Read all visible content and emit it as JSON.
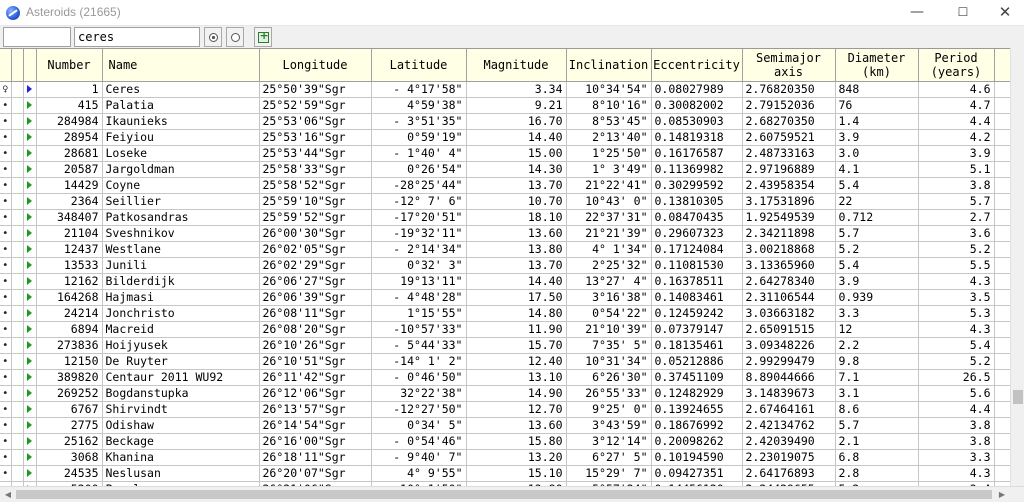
{
  "window": {
    "title": "Asteroids (21665)",
    "minimize_glyph": "—",
    "maximize_glyph": "☐",
    "close_glyph": "✕"
  },
  "toolbar": {
    "field1_value": "",
    "search_value": "ceres"
  },
  "table": {
    "headers": {
      "number": "Number",
      "name": "Name",
      "longitude": "Longitude",
      "latitude": "Latitude",
      "magnitude": "Magnitude",
      "inclination": "Inclination",
      "eccentricity": "Eccentricity",
      "semimajor_line1": "Semimajor",
      "semimajor_line2": "axis",
      "diameter_line1": "Diameter",
      "diameter_line2": "(km)",
      "period_line1": "Period",
      "period_line2": "(years)"
    },
    "rows": [
      {
        "mark": "♀",
        "number": "1",
        "name": "Ceres",
        "longitude": "25°50'39\"Sgr",
        "latitude": "- 4°17'58\"",
        "magnitude": "3.34",
        "inclination": "10°34'54\"",
        "eccentricity": "0.08027989",
        "semimajor": "2.76820350",
        "diameter": "848",
        "period": "4.6"
      },
      {
        "mark": "•",
        "number": "415",
        "name": "Palatia",
        "longitude": "25°52'59\"Sgr",
        "latitude": "4°59'38\"",
        "magnitude": "9.21",
        "inclination": "8°10'16\"",
        "eccentricity": "0.30082002",
        "semimajor": "2.79152036",
        "diameter": "76",
        "period": "4.7"
      },
      {
        "mark": "•",
        "number": "284984",
        "name": "Ikaunieks",
        "longitude": "25°53'06\"Sgr",
        "latitude": "- 3°51'35\"",
        "magnitude": "16.70",
        "inclination": "8°53'45\"",
        "eccentricity": "0.08530903",
        "semimajor": "2.68270350",
        "diameter": "1.4",
        "period": "4.4"
      },
      {
        "mark": "•",
        "number": "28954",
        "name": "Feiyiou",
        "longitude": "25°53'16\"Sgr",
        "latitude": "0°59'19\"",
        "magnitude": "14.40",
        "inclination": "2°13'40\"",
        "eccentricity": "0.14819318",
        "semimajor": "2.60759521",
        "diameter": "3.9",
        "period": "4.2"
      },
      {
        "mark": "•",
        "number": "28681",
        "name": "Loseke",
        "longitude": "25°53'44\"Sgr",
        "latitude": "- 1°40' 4\"",
        "magnitude": "15.00",
        "inclination": "1°25'50\"",
        "eccentricity": "0.16176587",
        "semimajor": "2.48733163",
        "diameter": "3.0",
        "period": "3.9"
      },
      {
        "mark": "•",
        "number": "20587",
        "name": "Jargoldman",
        "longitude": "25°58'33\"Sgr",
        "latitude": "0°26'54\"",
        "magnitude": "14.30",
        "inclination": "1° 3'49\"",
        "eccentricity": "0.11369982",
        "semimajor": "2.97196889",
        "diameter": "4.1",
        "period": "5.1"
      },
      {
        "mark": "•",
        "number": "14429",
        "name": "Coyne",
        "longitude": "25°58'52\"Sgr",
        "latitude": "-28°25'44\"",
        "magnitude": "13.70",
        "inclination": "21°22'41\"",
        "eccentricity": "0.30299592",
        "semimajor": "2.43958354",
        "diameter": "5.4",
        "period": "3.8"
      },
      {
        "mark": "•",
        "number": "2364",
        "name": "Seillier",
        "longitude": "25°59'10\"Sgr",
        "latitude": "-12° 7' 6\"",
        "magnitude": "10.70",
        "inclination": "10°43' 0\"",
        "eccentricity": "0.13810305",
        "semimajor": "3.17531896",
        "diameter": "22",
        "period": "5.7"
      },
      {
        "mark": "•",
        "number": "348407",
        "name": "Patkosandras",
        "longitude": "25°59'52\"Sgr",
        "latitude": "-17°20'51\"",
        "magnitude": "18.10",
        "inclination": "22°37'31\"",
        "eccentricity": "0.08470435",
        "semimajor": "1.92549539",
        "diameter": "0.712",
        "period": "2.7"
      },
      {
        "mark": "•",
        "number": "21104",
        "name": "Sveshnikov",
        "longitude": "26°00'30\"Sgr",
        "latitude": "-19°32'11\"",
        "magnitude": "13.60",
        "inclination": "21°21'39\"",
        "eccentricity": "0.29607323",
        "semimajor": "2.34211898",
        "diameter": "5.7",
        "period": "3.6"
      },
      {
        "mark": "•",
        "number": "12437",
        "name": "Westlane",
        "longitude": "26°02'05\"Sgr",
        "latitude": "- 2°14'34\"",
        "magnitude": "13.80",
        "inclination": "4° 1'34\"",
        "eccentricity": "0.17124084",
        "semimajor": "3.00218868",
        "diameter": "5.2",
        "period": "5.2"
      },
      {
        "mark": "•",
        "number": "13533",
        "name": "Junili",
        "longitude": "26°02'29\"Sgr",
        "latitude": "0°32' 3\"",
        "magnitude": "13.70",
        "inclination": "2°25'32\"",
        "eccentricity": "0.11081530",
        "semimajor": "3.13365960",
        "diameter": "5.4",
        "period": "5.5"
      },
      {
        "mark": "•",
        "number": "12162",
        "name": "Bilderdijk",
        "longitude": "26°06'27\"Sgr",
        "latitude": "19°13'11\"",
        "magnitude": "14.40",
        "inclination": "13°27' 4\"",
        "eccentricity": "0.16378511",
        "semimajor": "2.64278340",
        "diameter": "3.9",
        "period": "4.3"
      },
      {
        "mark": "•",
        "number": "164268",
        "name": "Hajmasi",
        "longitude": "26°06'39\"Sgr",
        "latitude": "- 4°48'28\"",
        "magnitude": "17.50",
        "inclination": "3°16'38\"",
        "eccentricity": "0.14083461",
        "semimajor": "2.31106544",
        "diameter": "0.939",
        "period": "3.5"
      },
      {
        "mark": "•",
        "number": "24214",
        "name": "Jonchristo",
        "longitude": "26°08'11\"Sgr",
        "latitude": "1°15'55\"",
        "magnitude": "14.80",
        "inclination": "0°54'22\"",
        "eccentricity": "0.12459242",
        "semimajor": "3.03663182",
        "diameter": "3.3",
        "period": "5.3"
      },
      {
        "mark": "•",
        "number": "6894",
        "name": "Macreid",
        "longitude": "26°08'20\"Sgr",
        "latitude": "-10°57'33\"",
        "magnitude": "11.90",
        "inclination": "21°10'39\"",
        "eccentricity": "0.07379147",
        "semimajor": "2.65091515",
        "diameter": "12",
        "period": "4.3"
      },
      {
        "mark": "•",
        "number": "273836",
        "name": "Hoijyusek",
        "longitude": "26°10'26\"Sgr",
        "latitude": "- 5°44'33\"",
        "magnitude": "15.70",
        "inclination": "7°35' 5\"",
        "eccentricity": "0.18135461",
        "semimajor": "3.09348226",
        "diameter": "2.2",
        "period": "5.4"
      },
      {
        "mark": "•",
        "number": "12150",
        "name": "De Ruyter",
        "longitude": "26°10'51\"Sgr",
        "latitude": "-14° 1' 2\"",
        "magnitude": "12.40",
        "inclination": "10°31'34\"",
        "eccentricity": "0.05212886",
        "semimajor": "2.99299479",
        "diameter": "9.8",
        "period": "5.2"
      },
      {
        "mark": "•",
        "number": "389820",
        "name": "Centaur 2011 WU92",
        "longitude": "26°11'42\"Sgr",
        "latitude": "- 0°46'50\"",
        "magnitude": "13.10",
        "inclination": "6°26'30\"",
        "eccentricity": "0.37451109",
        "semimajor": "8.89044666",
        "diameter": "7.1",
        "period": "26.5"
      },
      {
        "mark": "•",
        "number": "269252",
        "name": "Bogdanstupka",
        "longitude": "26°12'06\"Sgr",
        "latitude": "32°22'38\"",
        "magnitude": "14.90",
        "inclination": "26°55'33\"",
        "eccentricity": "0.12482929",
        "semimajor": "3.14839673",
        "diameter": "3.1",
        "period": "5.6"
      },
      {
        "mark": "•",
        "number": "6767",
        "name": "Shirvindt",
        "longitude": "26°13'57\"Sgr",
        "latitude": "-12°27'50\"",
        "magnitude": "12.70",
        "inclination": "9°25' 0\"",
        "eccentricity": "0.13924655",
        "semimajor": "2.67464161",
        "diameter": "8.6",
        "period": "4.4"
      },
      {
        "mark": "•",
        "number": "2775",
        "name": "Odishaw",
        "longitude": "26°14'54\"Sgr",
        "latitude": "0°34' 5\"",
        "magnitude": "13.60",
        "inclination": "3°43'59\"",
        "eccentricity": "0.18676992",
        "semimajor": "2.42134762",
        "diameter": "5.7",
        "period": "3.8"
      },
      {
        "mark": "•",
        "number": "25162",
        "name": "Beckage",
        "longitude": "26°16'00\"Sgr",
        "latitude": "- 0°54'46\"",
        "magnitude": "15.80",
        "inclination": "3°12'14\"",
        "eccentricity": "0.20098262",
        "semimajor": "2.42039490",
        "diameter": "2.1",
        "period": "3.8"
      },
      {
        "mark": "•",
        "number": "3068",
        "name": "Khanina",
        "longitude": "26°18'11\"Sgr",
        "latitude": "- 9°40' 7\"",
        "magnitude": "13.20",
        "inclination": "6°27' 5\"",
        "eccentricity": "0.10194590",
        "semimajor": "2.23019075",
        "diameter": "6.8",
        "period": "3.3"
      },
      {
        "mark": "•",
        "number": "24535",
        "name": "Neslusan",
        "longitude": "26°20'07\"Sgr",
        "latitude": "4° 9'55\"",
        "magnitude": "15.10",
        "inclination": "15°29' 7\"",
        "eccentricity": "0.09427351",
        "semimajor": "2.64176893",
        "diameter": "2.8",
        "period": "4.3"
      },
      {
        "mark": "•",
        "number": "5200",
        "name": "Pamal",
        "longitude": "26°21'06\"Sgr",
        "latitude": "-10° 1'50\"",
        "magnitude": "13.80",
        "inclination": "5°57'24\"",
        "eccentricity": "0.14456120",
        "semimajor": "2.24429655",
        "diameter": "5.2",
        "period": "3.4"
      }
    ]
  },
  "colors": {
    "header_bg": "#ffffe6",
    "row_marker": "#1f9b1f",
    "selected_marker": "#2026d8"
  }
}
